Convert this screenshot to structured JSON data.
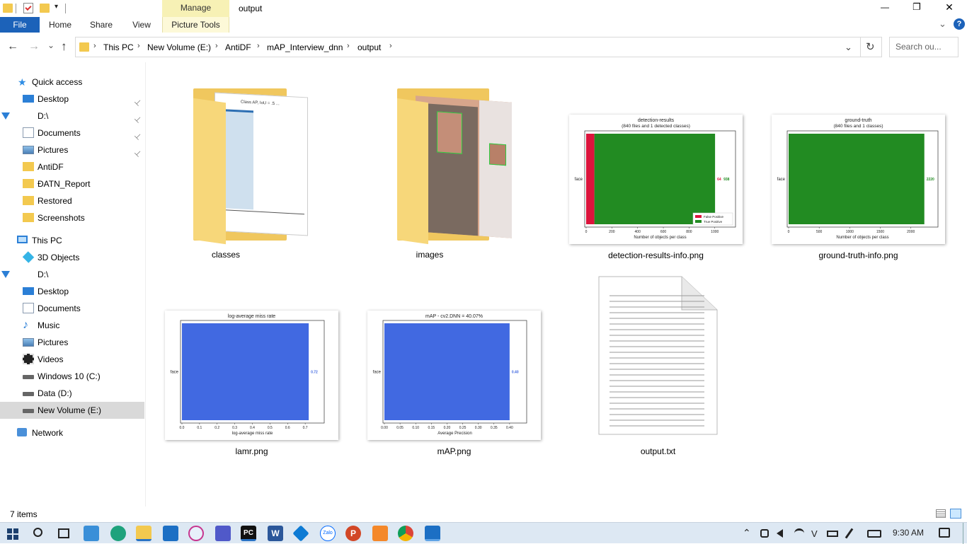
{
  "window": {
    "title": "output",
    "manage_tab": "Manage",
    "minimize": "—",
    "maximize": "❐",
    "close": "✕"
  },
  "ribbon": {
    "file": "File",
    "home": "Home",
    "share": "Share",
    "view": "View",
    "picture_tools": "Picture Tools",
    "expand": "⌄",
    "help": "?"
  },
  "nav_buttons": {
    "back": "←",
    "forward": "→",
    "recent": "⌄",
    "up": "↑"
  },
  "address": {
    "crumbs": [
      "This PC",
      "New Volume (E:)",
      "AntiDF",
      "mAP_Interview_dnn",
      "output"
    ],
    "dropdown": "⌄",
    "refresh": "↻"
  },
  "search": {
    "placeholder": "Search ou..."
  },
  "sidebar": {
    "quick_access": "Quick access",
    "quick_items": [
      {
        "label": "Desktop",
        "icon": "desktop-icon",
        "pinned": true
      },
      {
        "label": "D:\\",
        "icon": "download-icon",
        "pinned": true
      },
      {
        "label": "Documents",
        "icon": "documents-icon",
        "pinned": true
      },
      {
        "label": "Pictures",
        "icon": "pictures-icon",
        "pinned": true
      },
      {
        "label": "AntiDF",
        "icon": "folder-icon",
        "pinned": false
      },
      {
        "label": "ĐATN_Report",
        "icon": "folder-icon",
        "pinned": false
      },
      {
        "label": "Restored",
        "icon": "folder-icon",
        "pinned": false
      },
      {
        "label": "Screenshots",
        "icon": "folder-icon",
        "pinned": false
      }
    ],
    "this_pc": "This PC",
    "pc_items": [
      {
        "label": "3D Objects",
        "icon": "3d-objects-icon"
      },
      {
        "label": "D:\\",
        "icon": "download-icon"
      },
      {
        "label": "Desktop",
        "icon": "desktop-icon"
      },
      {
        "label": "Documents",
        "icon": "documents-icon"
      },
      {
        "label": "Music",
        "icon": "music-icon"
      },
      {
        "label": "Pictures",
        "icon": "pictures-icon"
      },
      {
        "label": "Videos",
        "icon": "videos-icon"
      },
      {
        "label": "Windows 10 (C:)",
        "icon": "drive-icon"
      },
      {
        "label": "Data (D:)",
        "icon": "drive-icon"
      },
      {
        "label": "New Volume (E:)",
        "icon": "drive-icon"
      }
    ],
    "network": "Network",
    "pin_glyph": "📌"
  },
  "files": [
    {
      "name": "classes",
      "type": "folder"
    },
    {
      "name": "images",
      "type": "folder"
    },
    {
      "name": "detection-results-info.png",
      "type": "image"
    },
    {
      "name": "ground-truth-info.png",
      "type": "image"
    },
    {
      "name": "lamr.png",
      "type": "image"
    },
    {
      "name": "mAP.png",
      "type": "image"
    },
    {
      "name": "output.txt",
      "type": "text"
    }
  ],
  "thumbs": {
    "classes_chart": {
      "title": "Class AP, IoU = .5 ..."
    },
    "detection": {
      "title": "detection-results",
      "subtitle": "(840 files and 1 detected classes)",
      "ylabel": "face",
      "xlabel": "Number of objects per class",
      "ticks": [
        "0",
        "200",
        "400",
        "600",
        "800",
        "1000"
      ],
      "fp_value": 64,
      "tp_value": 938,
      "fp_label": "64",
      "tp_label": "938",
      "legend_fp": "False Positive",
      "legend_tp": "True Positive",
      "xlim": [
        0,
        1150
      ],
      "colors": {
        "fp": "#dc143c",
        "tp": "#228b22"
      }
    },
    "ground_truth": {
      "title": "ground-truth",
      "subtitle": "(840 files and 1 classes)",
      "ylabel": "face",
      "xlabel": "Number of objects per class",
      "ticks": [
        "0",
        "500",
        "1000",
        "1500",
        "2000"
      ],
      "value": 2220,
      "value_label": "2220",
      "xlim": [
        0,
        2420
      ],
      "color": "#228b22"
    },
    "lamr": {
      "title": "log-average miss rate",
      "ylabel": "face",
      "xlabel": "log-average miss rate",
      "ticks": [
        "0.0",
        "0.1",
        "0.2",
        "0.3",
        "0.4",
        "0.5",
        "0.6",
        "0.7"
      ],
      "value": 0.72,
      "value_label": "0.72",
      "xlim": [
        0,
        0.8
      ],
      "color": "#4169e1"
    },
    "map": {
      "title": "mAP - cv2.DNN = 40.07%",
      "ylabel": "face",
      "xlabel": "Average Precision",
      "ticks": [
        "0.00",
        "0.05",
        "0.10",
        "0.15",
        "0.20",
        "0.25",
        "0.30",
        "0.35",
        "0.40"
      ],
      "value": 0.4,
      "value_label": "0.40",
      "xlim": [
        0,
        0.45
      ],
      "color": "#4169e1"
    }
  },
  "status": {
    "count": "7 items"
  },
  "taskbar": {
    "apps": [
      "windows-start-icon",
      "search-icon",
      "task-view-icon",
      "snipping-icon",
      "edge-icon",
      "file-explorer-icon",
      "mail-icon",
      "paint3d-icon",
      "teams-icon",
      "pycharm-icon",
      "word-icon",
      "vscode-icon",
      "zalo-icon",
      "powerpoint-icon",
      "photo-editor-icon",
      "chrome-icon",
      "photos-icon"
    ],
    "pycharm_label": "PC",
    "word_label": "W",
    "zalo_label": "Zalo",
    "ppt_label": "P",
    "time": "9:30 AM",
    "tray_up": "⌃"
  }
}
